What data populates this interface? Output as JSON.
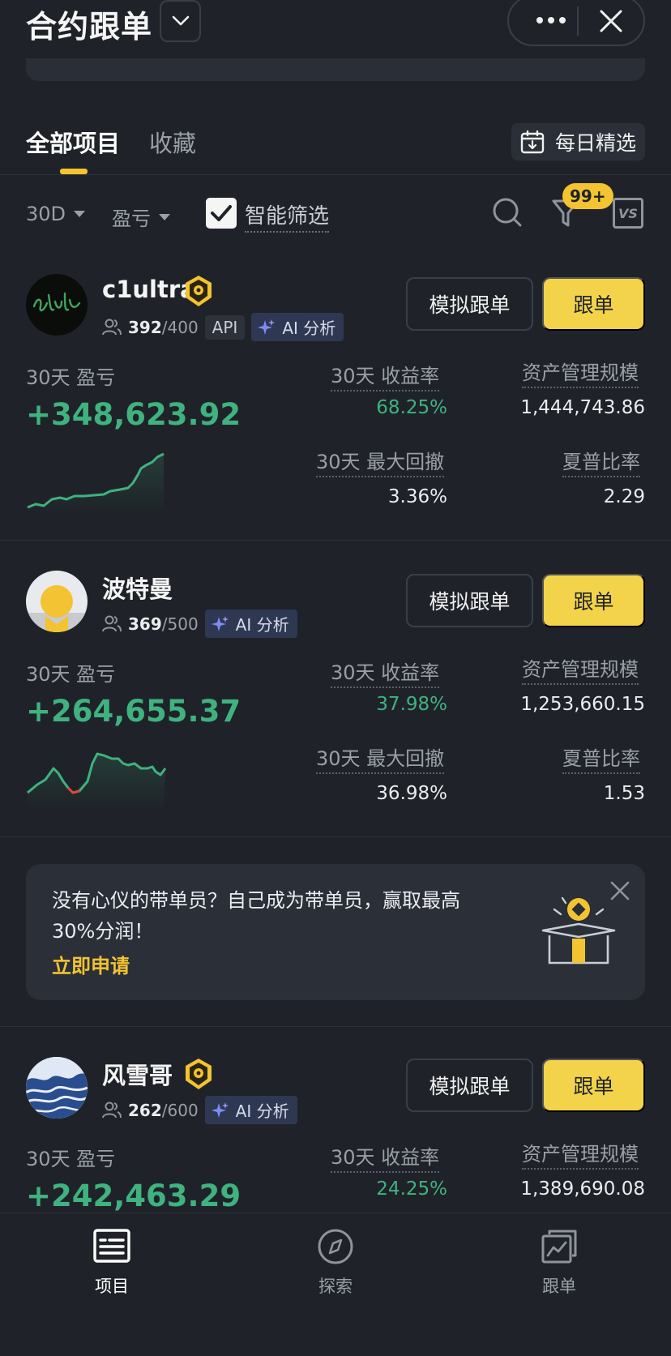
{
  "header": {
    "title": "合约跟单"
  },
  "tabs": {
    "all": "全部项目",
    "favorites": "收藏",
    "daily_pick": "每日精选"
  },
  "filters": {
    "period": "30D",
    "sort": "盈亏",
    "smart_filter": "智能筛选",
    "filter_badge": "99+",
    "vs": "VS"
  },
  "traders": [
    {
      "name": "c1ultra",
      "followers": "392",
      "capacity": "/400",
      "api_tag": "API",
      "ai_tag": "AI 分析",
      "pnl_label": "30天 盈亏",
      "pnl": "+348,623.92",
      "roi_label": "30天 收益率",
      "roi": "68.25%",
      "aum_label": "资产管理规模",
      "aum": "1,444,743.86",
      "mdd_label": "30天 最大回撤",
      "mdd": "3.36%",
      "sharpe_label": "夏普比率",
      "sharpe": "2.29",
      "sim_button": "模拟跟单",
      "follow_button": "跟单"
    },
    {
      "name": "波特曼",
      "followers": "369",
      "capacity": "/500",
      "ai_tag": "AI 分析",
      "pnl_label": "30天 盈亏",
      "pnl": "+264,655.37",
      "roi_label": "30天 收益率",
      "roi": "37.98%",
      "aum_label": "资产管理规模",
      "aum": "1,253,660.15",
      "mdd_label": "30天 最大回撤",
      "mdd": "36.98%",
      "sharpe_label": "夏普比率",
      "sharpe": "1.53",
      "sim_button": "模拟跟单",
      "follow_button": "跟单"
    },
    {
      "name": "风雪哥",
      "followers": "262",
      "capacity": "/600",
      "ai_tag": "AI 分析",
      "pnl_label": "30天 盈亏",
      "pnl": "+242,463.29",
      "roi_label": "30天 收益率",
      "roi": "24.25%",
      "aum_label": "资产管理规模",
      "aum": "1,389,690.08",
      "sim_button": "模拟跟单",
      "follow_button": "跟单"
    }
  ],
  "promo": {
    "text": "没有心仪的带单员？自己成为带单员，赢取最高30%分润！",
    "link": "立即申请"
  },
  "bottom_nav": [
    {
      "label": "项目",
      "icon": "list-icon",
      "active": true
    },
    {
      "label": "探索",
      "icon": "compass-icon",
      "active": false
    },
    {
      "label": "跟单",
      "icon": "copy-chart-icon",
      "active": false
    }
  ],
  "colors": {
    "background": "#1f2329",
    "accent": "#f3c331",
    "profit_green": "#3fb27f",
    "follow_button": "#f3d34a"
  }
}
